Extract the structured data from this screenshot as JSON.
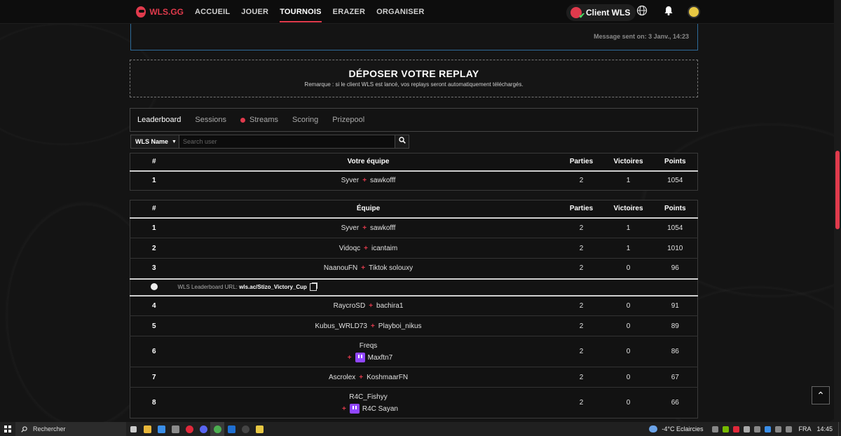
{
  "nav": {
    "logo": "WLS.GG",
    "items": [
      "ACCUEIL",
      "JOUER",
      "TOURNOIS",
      "ERAZER",
      "ORGANISER"
    ],
    "active": "TOURNOIS",
    "client_label": "Client WLS"
  },
  "message": {
    "time": "Message sent on: 3 Janv., 14:23"
  },
  "replay": {
    "title": "DÉPOSER VOTRE REPLAY",
    "note": "Remarque : si le client WLS est lancé, vos replays seront automatiquement téléchargés."
  },
  "tabs": [
    "Leaderboard",
    "Sessions",
    "Streams",
    "Scoring",
    "Prizepool"
  ],
  "search": {
    "dropdown": "WLS Name",
    "placeholder": "Search user"
  },
  "team_table": {
    "headers": [
      "#",
      "Votre équipe",
      "Parties",
      "Victoires",
      "Points"
    ],
    "row": {
      "rank": "1",
      "p1": "Syver",
      "p2": "sawkofff",
      "parties": "2",
      "victoires": "1",
      "points": "1054"
    }
  },
  "leaderboard": {
    "headers": [
      "#",
      "Équipe",
      "Parties",
      "Victoires",
      "Points"
    ],
    "rows_top": [
      {
        "rank": "1",
        "p1": "Syver",
        "p2": "sawkofff",
        "parties": "2",
        "victoires": "1",
        "points": "1054"
      },
      {
        "rank": "2",
        "p1": "Vidoqc",
        "p2": "icantaim",
        "parties": "2",
        "victoires": "1",
        "points": "1010"
      },
      {
        "rank": "3",
        "p1": "NaanouFN",
        "p2": "Tiktok solouxy",
        "parties": "2",
        "victoires": "0",
        "points": "96"
      }
    ],
    "url_label": "WLS Leaderboard URL:",
    "url_value": "wls.ac/Stizo_Victory_Cup",
    "rows_bottom": [
      {
        "rank": "4",
        "p1": "RaycroSD",
        "p2": "bachira1",
        "parties": "2",
        "victoires": "0",
        "points": "91"
      },
      {
        "rank": "5",
        "p1": "Kubus_WRLD73",
        "p2": "Playboi_nikus",
        "parties": "2",
        "victoires": "0",
        "points": "89"
      },
      {
        "rank": "6",
        "p1": "Freqs",
        "p2": "Maxftn7",
        "parties": "2",
        "victoires": "0",
        "points": "86",
        "twitch": true
      },
      {
        "rank": "7",
        "p1": "Ascrolex",
        "p2": "KoshmaarFN",
        "parties": "2",
        "victoires": "0",
        "points": "67"
      },
      {
        "rank": "8",
        "p1": "R4C_Fishyy",
        "p2": "R4C Sayan",
        "parties": "2",
        "victoires": "0",
        "points": "66",
        "twitch": true
      }
    ]
  },
  "taskbar": {
    "search": "Rechercher",
    "weather": "-4°C Eclaircies",
    "lang": "FRA",
    "time": "14:45"
  }
}
